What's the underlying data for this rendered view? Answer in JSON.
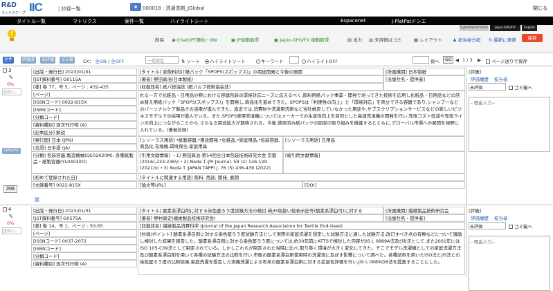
{
  "header": {
    "logo_main": "R&D",
    "logo_sub": "ランドスケープ",
    "logo_mark": "IIC",
    "app_title": "| 抄録一覧",
    "doc_id": "000018 : 洗濯洗剤_JGlobal",
    "close": "閉じる"
  },
  "nav": [
    "タイトル一覧",
    "マトリクス",
    "案件一覧",
    "ハイライトシート",
    "Espacenet",
    "J-PlatPatドシエ"
  ],
  "toolbar": {
    "items": [
      "削除",
      "ChatGPT要約・KW",
      "JP自動取得",
      "Japio-GPG/FX 自動取得",
      "出力",
      "未評価はゴミ",
      "レイアウト",
      "担当者分担",
      "最新に更新"
    ],
    "badges": [
      "CyberPatent Desk",
      "Japio-GPG/FX",
      "English"
    ],
    "save": "保存"
  },
  "controls": {
    "tabs": [
      "全件",
      "評価済",
      "未評価",
      "ゴミ箱"
    ],
    "ck_label": "CK：",
    "ck_on": "全ON",
    "ck_off": "全OFF",
    "select_placeholder": "一括設定",
    "sort": "ソート",
    "radio_highlight": "ハイライトソート",
    "radio_keyword": "キーワード",
    "radio_highlight_off": "ハイライトOFF",
    "page_label": "頁へ",
    "go": "GO",
    "page_info": "1 / 3",
    "keep_page": "ページ送りで保存"
  },
  "records": [
    {
      "num": "3",
      "pct": "0%",
      "status": "重要なし",
      "gpg": "GPG/FX",
      "detail": "詳細",
      "pub_date": "[出版・発行日] 2023/01/01",
      "jst": "[JST資料番号] G0115A",
      "vol": "[巻] 卷 77、号 5、ページ : 432-435",
      "page": "[ページ]",
      "issn": "[ISSNコード] 0022-815X",
      "isbn": "[ISBNコード]",
      "bunrui": "[分類コード]",
      "doctype": "[資料種別] 逐次刊行物 (A)",
      "kiji": "[記事区分] 解説",
      "country": "[発行国] 日本 (JPN)",
      "lang": "[言語] 日本語 (JA)",
      "bunya": "[分類] 包装容器,製造機械(QE02020M), 各種紙製品・紙製容器(YL04030O)",
      "first_reg": "[初めて登録された日]",
      "doc_no": "[文献番号] 0022-815X",
      "title": "[タイトル] 家飲料向け紙パック「SPOPS(スポップス)」の用途開発と今後の展開",
      "author": "[著者] 野田真治(日本製紙)",
      "org": "[収載誌名] 紙パ技協誌 (紙パルプ技術協会誌)",
      "abstract": "れる一方で化粧品・日用品分野における容器包装の環境対応ニーズに応えるべく,飲料用紙パック事業・開発で培ってきた技術を応用し化粧品・日用品などの詰め替え用紙パック「SPOPS(スポップス)」を開発し,商品化を進めてきた。SPOPSは「利便性の向上」と「環境対応」を両立できる容器であり,シャンプーなどのパーソナルケア製品での活用が進んできた。直近では,消費財や洗濯用洗剤など当社推定していなかった用途や,サブスクリプションサービスなどの新しいビジネスモデルでの採用が進んでいる。また,SPOPS専用充填機についてはメーカーでの生産性向上を目的とした高速充填機の開発を行い,充填コスト低減や充填ラインの向上につながることから,さらなる用途拡大が期待される。今後,使用済み紙パックの回収の取り組みを推進するとともに,グローバル市場への展開を視野に入れている。(著者抄録)",
      "shisoraus": "[シソーラス用語] *紙製容器,*用途開発,*化粧品,*家庭用品,*包装容器,商品化,充填機,環境保全,家庭用具",
      "ref": "[引用文献情報] ・1) 野田真治:第54回全日本包装技術研究大会 京都(2016),233-236\\n・2) Noda T.:JPI Journal. 59 (2) 126-129 (2021)\\n・3) Noda T.:JAPAN TAPPI J. 76 (5) 436-439 (2022)",
      "kanren": "[タイトルに関連する用語] 飲料, 用途, 開発, 展開",
      "ronbun": "[論文等URL]",
      "doi": "[DOI]",
      "shozoku": "[所属機関] 日本製紙",
      "shuppan": "[出版社名・提供者]",
      "jsiso": "[シソーラス用語] 日用品",
      "hikibun": "[被引用文献情報]"
    },
    {
      "num": "4",
      "pct": "0%",
      "status": "重要なし",
      "pub_date": "[出版・発行日] 2023/01/01",
      "jst": "[JST資料番号] G0575A",
      "vol": "[巻] 卷 14、号 1、ページ : 50-55",
      "page": "[ページ]",
      "issn": "[ISSNコード] 0037-2072",
      "isbn": "[ISBNコード]",
      "bunrui": "[分類コード]",
      "doctype": "[資料種別] 逐次刊行物 (A)",
      "title": "[タイトル] 酸素系漂白剤に対する染色堅ろう度試験方法の検討-新JIS取扱い絵表示記号(酸素系漂白可)に対する",
      "author": "[著者] 野村真史(繊維製品技術研究会)",
      "org": "[収載誌名] 繊維製品消費科学 (Journal of the Japan Research Association for Textile End-Uses)",
      "abstract": "[抄録/ポイント] 酸素系漂白剤に対する染色堅ろう度試験方法として実際の家庭洗濯を想定した試験方法に適した試験方法,改訂すべき点の有無などについて議論し検討した結果を報告した。酸素系漂白剤に対する染色堅ろう度については,約30年前にATTSで検討した内容がJIS L 0889A法及びB法として,また2001年にはISO 105-C09法として制定されている。しかしこれらが制定された当時に比べ,取り巻く環境が大きく変化してきた。そこでモデル洗濯機としての家庭洗濯方法及び酸素系漂白剤を用いて各種の試験方法の比較を行い,市販の酸素系漂白剤使用時の洗濯液に及ぼす影響について調べた。各種試料を用いたISO法とJIS法との染色堅ろう度の比較結果,家庭洗濯を想定した実機洗濯による布帛の酸素系漂白剤に対する変退色評価を行い,JIS L 0889のB法を提案することにした。",
      "shozoku": "[所属機関] 繊維製品技術研究会",
      "shuppan": "[出版社名・提供者]"
    }
  ],
  "eval": {
    "label": "[評価]",
    "history": "評価履歴",
    "owner": "担当者",
    "unrated": "未評価",
    "gomi": "ゴミ箱へ",
    "reason_placeholder": "--理由入力--"
  },
  "colors": {
    "nav_bg": "#050505",
    "accent": "#3a70c8",
    "save": "#e84a2a",
    "pct": "#e02020"
  }
}
